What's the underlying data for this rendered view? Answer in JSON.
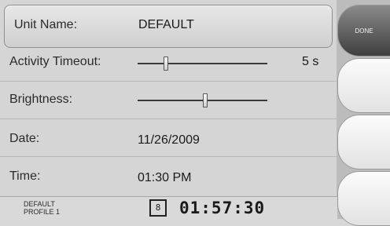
{
  "settings": {
    "unit_name": {
      "label": "Unit Name:",
      "value": "DEFAULT"
    },
    "activity_timeout": {
      "label": "Activity Timeout:",
      "value_text": "5 s",
      "slider_fraction": 0.22
    },
    "brightness": {
      "label": "Brightness:",
      "slider_fraction": 0.52
    },
    "date": {
      "label": "Date:",
      "value": "11/26/2009"
    },
    "time": {
      "label": "Time:",
      "value": "01:30 PM"
    }
  },
  "side_buttons": {
    "done_label": "DONE"
  },
  "status_bar": {
    "unit": "DEFAULT",
    "profile": "PROFILE 1",
    "lcd_indicator": "8",
    "clock": "01:57:30"
  }
}
